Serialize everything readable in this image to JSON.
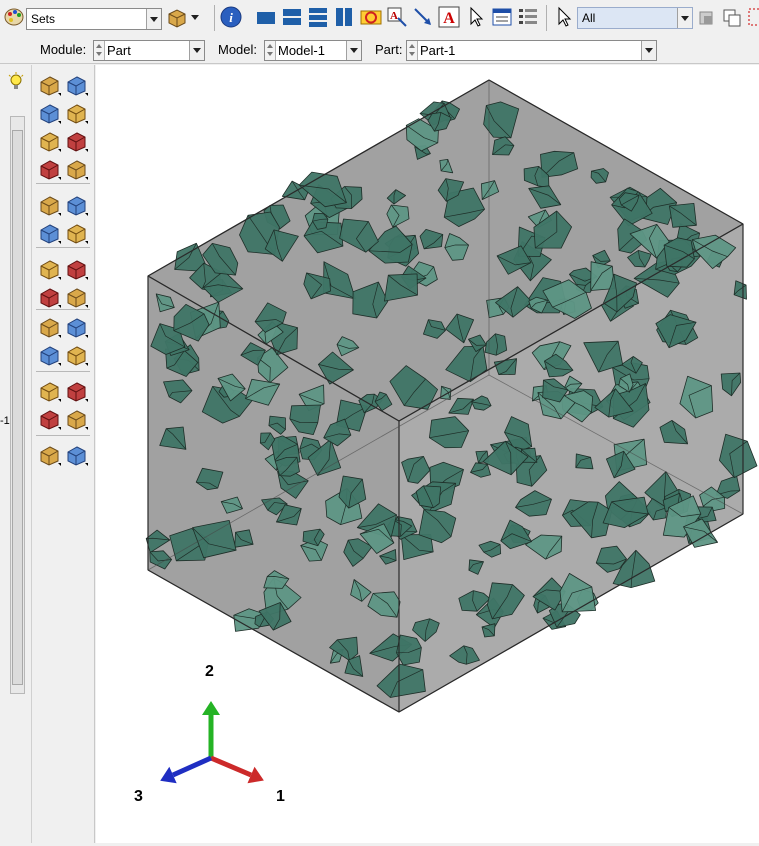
{
  "toolbar": {
    "sets_combo": "Sets",
    "selection_filter": "All",
    "icons": [
      "color-palette-icon",
      "box-view-icon",
      "info-icon",
      "render-wireframe-icon",
      "render-hidden-icon",
      "render-shaded-icon",
      "render-outline-icon",
      "view-cycle-icon",
      "datum-text-icon",
      "arrow-annotation-icon",
      "text-annotation-icon",
      "select-pointer-icon",
      "query-icon",
      "list-icon",
      "select-arrow-icon",
      "selection-option-icon",
      "selection-copy-icon",
      "selection-box-icon"
    ]
  },
  "context": {
    "module_label": "Module:",
    "module_value": "Part",
    "model_label": "Model:",
    "model_value": "Model-1",
    "part_label": "Part:",
    "part_value": "Part-1"
  },
  "tree": {
    "clip_text": "-1",
    "hint_icon": "lightbulb-icon"
  },
  "toolbox": {
    "tools": [
      "create-part-icon",
      "part-manager-icon",
      "extrude-solid-icon",
      "revolve-icon",
      "cut-plane-icon",
      "sweep-icon",
      "shell-icon",
      "wire-icon",
      "partition-cell-icon",
      "datum-point-icon",
      "edit-feature-icon",
      "datum-plane-icon",
      "reference-point-icon",
      "query-tool-icon",
      "create-set-icon",
      "delete-feature-icon",
      "point-coordinate-icon",
      "datum-axis-icon",
      "datum-csys-icon",
      "datum-vector-icon",
      "surface-icon",
      "skin-icon",
      "attribute-icon",
      "repair-tools-icon",
      "merge-icon",
      "virtual-topology-icon"
    ]
  },
  "viewport": {
    "triad": {
      "axis1_label": "1",
      "axis2_label": "2",
      "axis3_label": "3"
    },
    "colors": {
      "box_fill": "#9c9c9c",
      "aggregate_fill": "#3f7566",
      "aggregate_light": "#5e9685",
      "axis1": "#cc2a2a",
      "axis2": "#25b325",
      "axis3": "#1f2ec2"
    }
  }
}
